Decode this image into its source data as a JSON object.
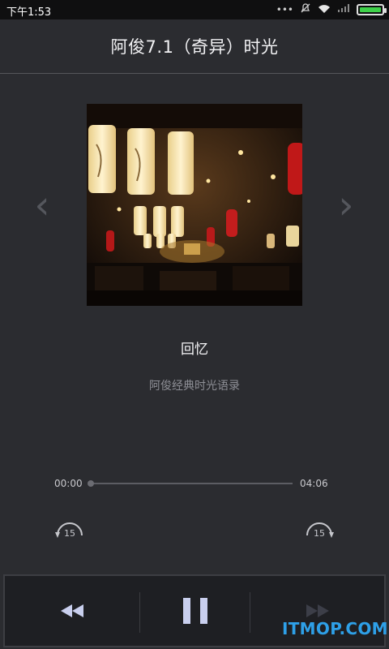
{
  "status_bar": {
    "time": "下午1:53",
    "icons": [
      "more-icon",
      "notification-off-icon",
      "wifi-icon",
      "signal-icon",
      "battery-icon"
    ],
    "battery_color": "#3fd24a"
  },
  "header": {
    "title": "阿俊7.1（奇异）时光"
  },
  "navigation": {
    "prev_icon": "chevron-left-icon",
    "next_icon": "chevron-right-icon",
    "prev_glyph": "‹",
    "next_glyph": "›"
  },
  "track": {
    "title": "回忆",
    "subtitle": "阿俊经典时光语录",
    "artwork": "restaurant-lanterns-photo"
  },
  "progress": {
    "current": "00:00",
    "total": "04:06",
    "fraction": 0.0
  },
  "skip": {
    "back_label": "15",
    "forward_label": "15",
    "back_icon": "rewind-15-icon",
    "forward_icon": "forward-15-icon"
  },
  "controls": {
    "rewind_icon": "rewind-icon",
    "pause_icon": "pause-icon",
    "forward_icon": "fast-forward-icon",
    "accent": "#c9cfee"
  },
  "watermark": {
    "text": "ITMOP.COM",
    "color": "#2ea0e8"
  }
}
